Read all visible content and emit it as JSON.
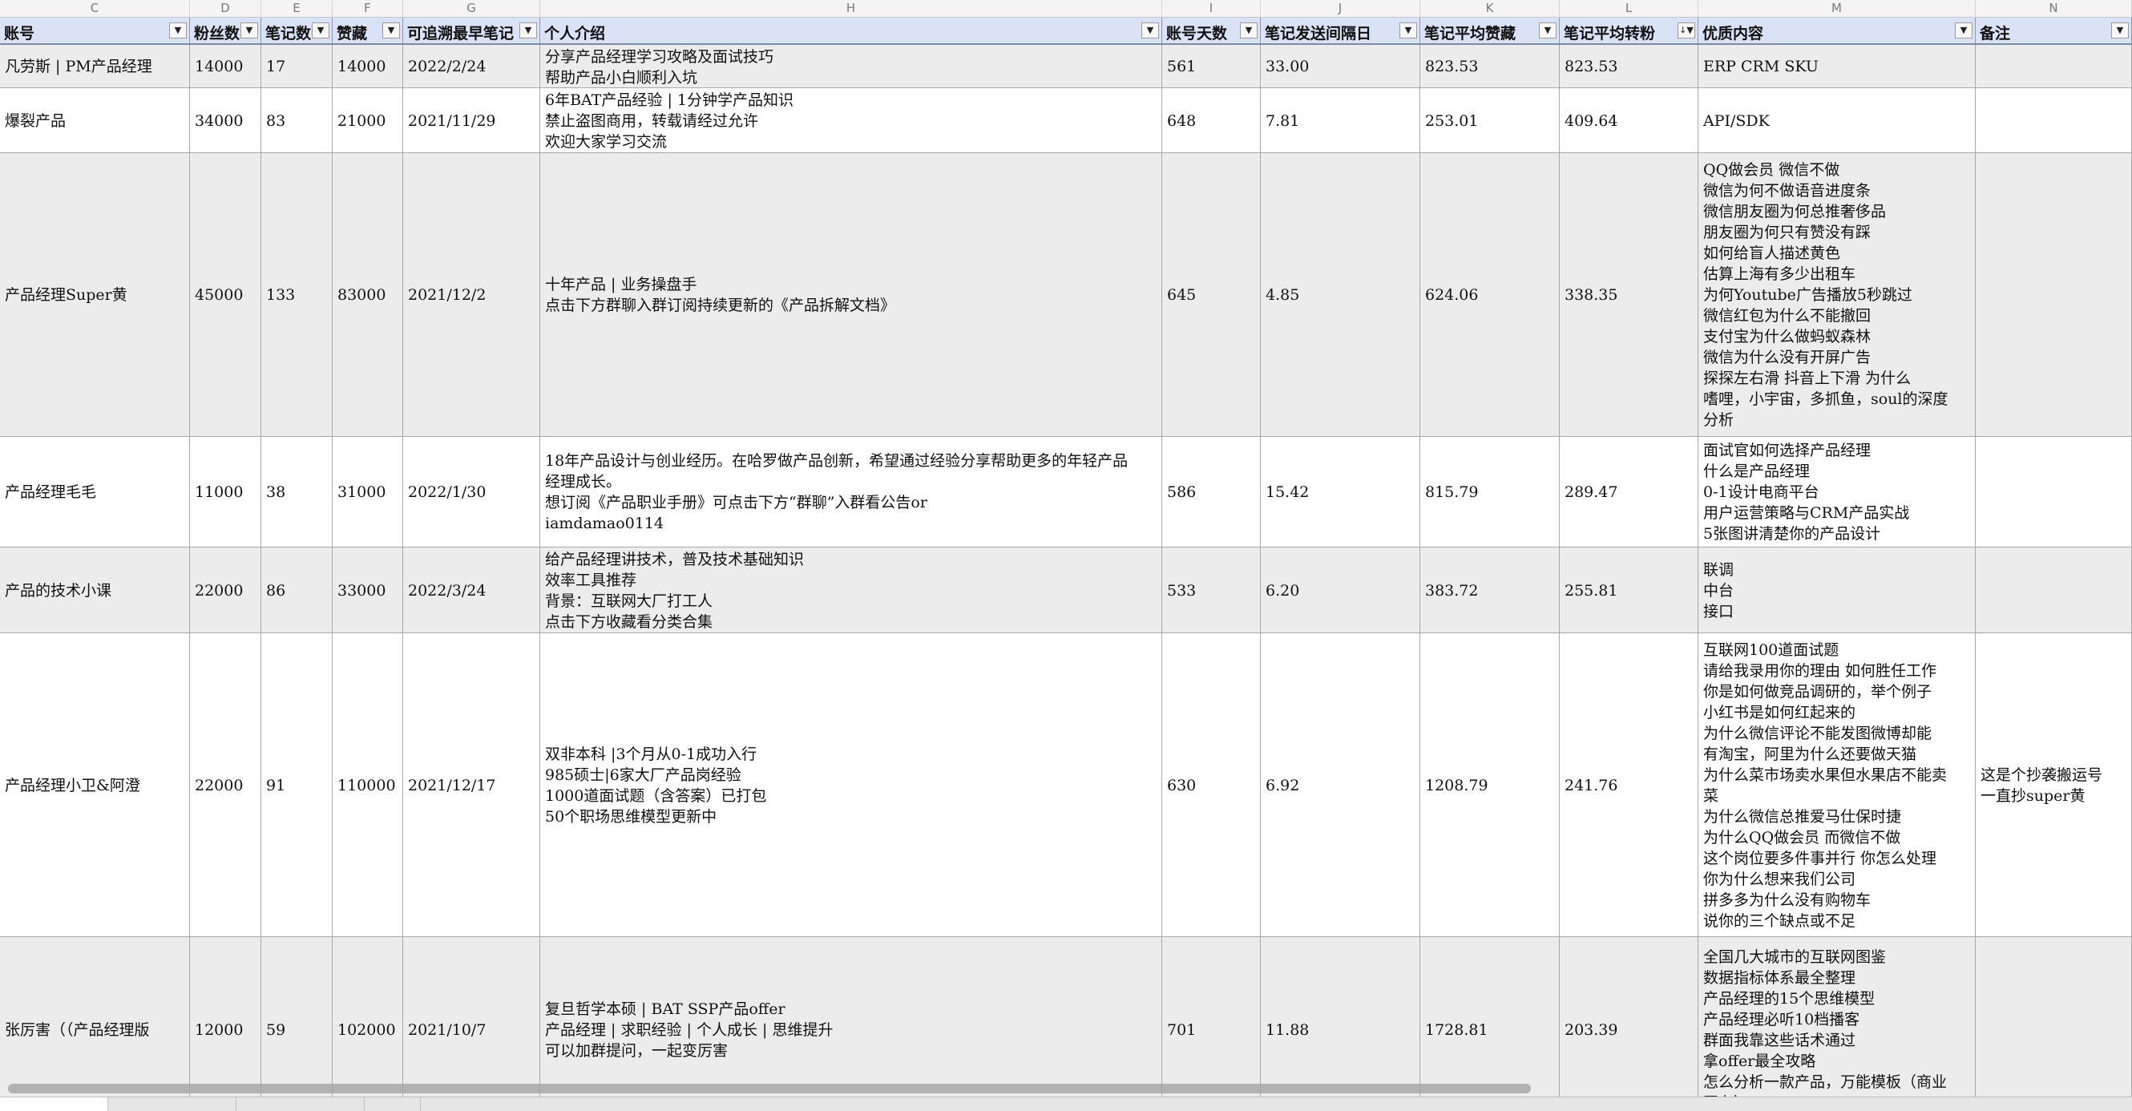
{
  "columns": [
    "C",
    "D",
    "E",
    "F",
    "G",
    "H",
    "I",
    "J",
    "K",
    "L",
    "M",
    "N"
  ],
  "headers": [
    {
      "label": "账号",
      "filter": "▼"
    },
    {
      "label": "粉丝数",
      "filter": "▼"
    },
    {
      "label": "笔记数",
      "filter": "▼"
    },
    {
      "label": "赞藏",
      "filter": "▼"
    },
    {
      "label": "可追溯最早笔记",
      "filter": "▼"
    },
    {
      "label": "个人介绍",
      "filter": "▼"
    },
    {
      "label": "账号天数",
      "filter": "▼"
    },
    {
      "label": "笔记发送间隔日",
      "filter": "▼"
    },
    {
      "label": "笔记平均赞藏",
      "filter": "▼"
    },
    {
      "label": "笔记平均转粉",
      "filter": "↓▼"
    },
    {
      "label": "优质内容",
      "filter": "▼"
    },
    {
      "label": "备注",
      "filter": "▼"
    }
  ],
  "rows": [
    {
      "account": "凡劳斯 | PM产品经理",
      "fans": "14000",
      "notes": "17",
      "likes": "14000",
      "earliest": "2022/2/24",
      "intro": "分享产品经理学习攻略及面试技巧\n帮助产品小白顺利入坑",
      "days": "561",
      "interval": "33.00",
      "avg_likes": "823.53",
      "avg_fans": "823.53",
      "quality": "ERP CRM SKU",
      "remark": ""
    },
    {
      "account": "爆裂产品",
      "fans": "34000",
      "notes": "83",
      "likes": "21000",
      "earliest": "2021/11/29",
      "intro": "6年BAT产品经验 | 1分钟学产品知识\n禁止盗图商用，转载请经过允许\n欢迎大家学习交流",
      "days": "648",
      "interval": "7.81",
      "avg_likes": "253.01",
      "avg_fans": "409.64",
      "quality": "API/SDK",
      "remark": ""
    },
    {
      "account": "产品经理Super黄",
      "fans": "45000",
      "notes": "133",
      "likes": "83000",
      "earliest": "2021/12/2",
      "intro": "十年产品 | 业务操盘手\n点击下方群聊入群订阅持续更新的《产品拆解文档》",
      "days": "645",
      "interval": "4.85",
      "avg_likes": "624.06",
      "avg_fans": "338.35",
      "quality": "QQ做会员 微信不做\n微信为何不做语音进度条\n微信朋友圈为何总推奢侈品\n朋友圈为何只有赞没有踩\n如何给盲人描述黄色\n估算上海有多少出租车\n为何Youtube广告播放5秒跳过\n微信红包为什么不能撤回\n支付宝为什么做蚂蚁森林\n微信为什么没有开屏广告\n探探左右滑 抖音上下滑 为什么\n嗜哩，小宇宙，多抓鱼，soul的深度\n分析",
      "remark": ""
    },
    {
      "account": "产品经理毛毛",
      "fans": "11000",
      "notes": "38",
      "likes": "31000",
      "earliest": "2022/1/30",
      "intro": "18年产品设计与创业经历。在哈罗做产品创新，希望通过经验分享帮助更多的年轻产品\n经理成长。\n想订阅《产品职业手册》可点击下方“群聊”入群看公告or\niamdamao0114",
      "days": "586",
      "interval": "15.42",
      "avg_likes": "815.79",
      "avg_fans": "289.47",
      "quality": "面试官如何选择产品经理\n什么是产品经理\n0-1设计电商平台\n用户运营策略与CRM产品实战\n5张图讲清楚你的产品设计",
      "remark": ""
    },
    {
      "account": "产品的技术小课",
      "fans": "22000",
      "notes": "86",
      "likes": "33000",
      "earliest": "2022/3/24",
      "intro": "给产品经理讲技术，普及技术基础知识\n效率工具推荐\n背景：互联网大厂打工人\n点击下方收藏看分类合集",
      "days": "533",
      "interval": "6.20",
      "avg_likes": "383.72",
      "avg_fans": "255.81",
      "quality": "联调\n中台\n接口",
      "remark": ""
    },
    {
      "account": "产品经理小卫&阿澄",
      "fans": "22000",
      "notes": "91",
      "likes": "110000",
      "earliest": "2021/12/17",
      "intro": "双非本科 |3个月从0-1成功入行\n985硕士|6家大厂产品岗经验\n1000道面试题（含答案）已打包\n50个职场思维模型更新中",
      "days": "630",
      "interval": "6.92",
      "avg_likes": "1208.79",
      "avg_fans": "241.76",
      "quality": "互联网100道面试题\n请给我录用你的理由 如何胜任工作\n你是如何做竞品调研的，举个例子\n小红书是如何红起来的\n为什么微信评论不能发图微博却能\n有淘宝，阿里为什么还要做天猫\n为什么菜市场卖水果但水果店不能卖\n菜\n为什么微信总推爱马仕保时捷\n为什么QQ做会员 而微信不做\n这个岗位要多件事并行 你怎么处理\n你为什么想来我们公司\n拼多多为什么没有购物车\n说你的三个缺点或不足",
      "remark": "这是个抄袭搬运号\n一直抄super黄"
    },
    {
      "account": "张厉害（（产品经理版",
      "fans": "12000",
      "notes": "59",
      "likes": "102000",
      "earliest": "2021/10/7",
      "intro": "复旦哲学本硕 | BAT SSP产品offer\n产品经理 | 求职经验 | 个人成长 | 思维提升\n可以加群提问，一起变厉害",
      "days": "701",
      "interval": "11.88",
      "avg_likes": "1728.81",
      "avg_fans": "203.39",
      "quality": "全国几大城市的互联网图鉴\n数据指标体系最全整理\n产品经理的15个思维模型\n产品经理必听10档播客\n群面我靠这些话术通过\n拿offer最全攻略\n怎么分析一款产品，万能模板（商业\n画布）",
      "remark": ""
    }
  ]
}
